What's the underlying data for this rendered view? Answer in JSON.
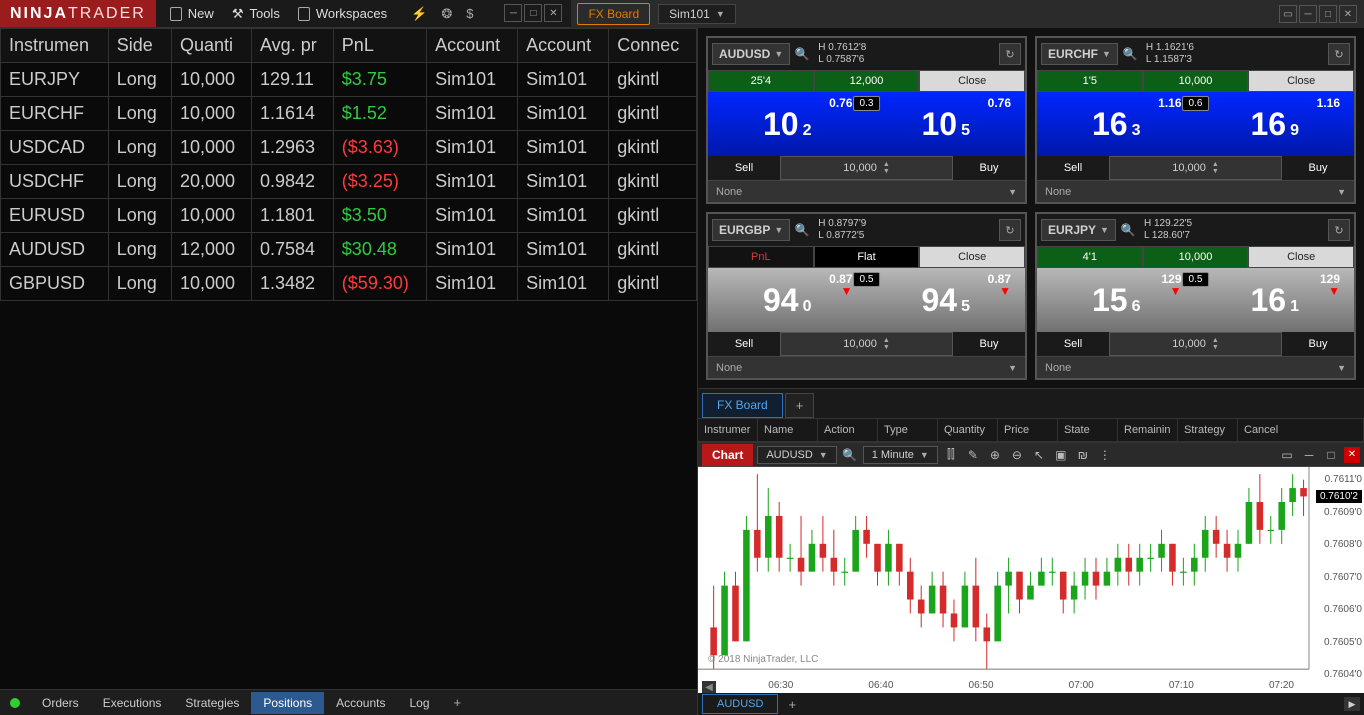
{
  "app": {
    "logo1": "NINJA",
    "logo2": "TRADER",
    "menu": {
      "new": "New",
      "tools": "Tools",
      "workspaces": "Workspaces"
    }
  },
  "fxboard_title": "FX Board",
  "account": "Sim101",
  "positions": {
    "headers": [
      "Instrumen",
      "Side",
      "Quanti",
      "Avg. pr",
      "PnL",
      "Account",
      "Account",
      "Connec"
    ],
    "rows": [
      {
        "inst": "EURJPY",
        "side": "Long",
        "qty": "10,000",
        "avg": "129.11",
        "pnl": "$3.75",
        "pnl_pos": true,
        "acc1": "Sim101",
        "acc2": "Sim101",
        "conn": "gkintl"
      },
      {
        "inst": "EURCHF",
        "side": "Long",
        "qty": "10,000",
        "avg": "1.1614",
        "pnl": "$1.52",
        "pnl_pos": true,
        "acc1": "Sim101",
        "acc2": "Sim101",
        "conn": "gkintl"
      },
      {
        "inst": "USDCAD",
        "side": "Long",
        "qty": "10,000",
        "avg": "1.2963",
        "pnl": "($3.63)",
        "pnl_pos": false,
        "acc1": "Sim101",
        "acc2": "Sim101",
        "conn": "gkintl"
      },
      {
        "inst": "USDCHF",
        "side": "Long",
        "qty": "20,000",
        "avg": "0.9842",
        "pnl": "($3.25)",
        "pnl_pos": false,
        "acc1": "Sim101",
        "acc2": "Sim101",
        "conn": "gkintl"
      },
      {
        "inst": "EURUSD",
        "side": "Long",
        "qty": "10,000",
        "avg": "1.1801",
        "pnl": "$3.50",
        "pnl_pos": true,
        "acc1": "Sim101",
        "acc2": "Sim101",
        "conn": "gkintl"
      },
      {
        "inst": "AUDUSD",
        "side": "Long",
        "qty": "12,000",
        "avg": "0.7584",
        "pnl": "$30.48",
        "pnl_pos": true,
        "acc1": "Sim101",
        "acc2": "Sim101",
        "conn": "gkintl"
      },
      {
        "inst": "GBPUSD",
        "side": "Long",
        "qty": "10,000",
        "avg": "1.3482",
        "pnl": "($59.30)",
        "pnl_pos": false,
        "acc1": "Sim101",
        "acc2": "Sim101",
        "conn": "gkintl"
      }
    ]
  },
  "bottom_tabs": {
    "items": [
      "Orders",
      "Executions",
      "Strategies",
      "Positions",
      "Accounts",
      "Log"
    ],
    "active": "Positions"
  },
  "fx_tiles": [
    {
      "pair": "AUDUSD",
      "hi": "H  0.7612'8",
      "lo": "L  0.7587'6",
      "cell1": "25'4",
      "cell1_cls": "qty",
      "cell2": "12,000",
      "cell2_cls": "qty",
      "cell3": "Close",
      "cell3_cls": "close",
      "left_top": "0.76",
      "left_big": "10",
      "left_sm": "2",
      "right_top": "0.76",
      "right_big": "10",
      "right_sm": "5",
      "spread": "0.3",
      "qty": "10,000",
      "atm": "None",
      "theme": "blue",
      "arrows": false
    },
    {
      "pair": "EURCHF",
      "hi": "H  1.1621'6",
      "lo": "L  1.1587'3",
      "cell1": "1'5",
      "cell1_cls": "qty",
      "cell2": "10,000",
      "cell2_cls": "qty",
      "cell3": "Close",
      "cell3_cls": "close",
      "left_top": "1.16",
      "left_big": "16",
      "left_sm": "3",
      "right_top": "1.16",
      "right_big": "16",
      "right_sm": "9",
      "spread": "0.6",
      "qty": "10,000",
      "atm": "None",
      "theme": "blue",
      "arrows": false
    },
    {
      "pair": "EURGBP",
      "hi": "H  0.8797'9",
      "lo": "L  0.8772'5",
      "cell1": "PnL",
      "cell1_cls": "pnl-label",
      "cell2": "Flat",
      "cell2_cls": "flat",
      "cell3": "Close",
      "cell3_cls": "close",
      "left_top": "0.87",
      "left_big": "94",
      "left_sm": "0",
      "right_top": "0.87",
      "right_big": "94",
      "right_sm": "5",
      "spread": "0.5",
      "qty": "10,000",
      "atm": "None",
      "theme": "gray",
      "arrows": true
    },
    {
      "pair": "EURJPY",
      "hi": "H  129.22'5",
      "lo": "L  128.60'7",
      "cell1": "4'1",
      "cell1_cls": "qty",
      "cell2": "10,000",
      "cell2_cls": "qty",
      "cell3": "Close",
      "cell3_cls": "close",
      "left_top": "129",
      "left_big": "15",
      "left_sm": "6",
      "right_top": "129",
      "right_big": "16",
      "right_sm": "1",
      "spread": "0.5",
      "qty": "10,000",
      "atm": "None",
      "theme": "gray",
      "arrows": true
    }
  ],
  "tile_labels": {
    "sell": "Sell",
    "buy": "Buy"
  },
  "fx_tabrow": {
    "tab": "FX Board"
  },
  "order_headers": [
    "Instrumer",
    "Name",
    "Action",
    "Type",
    "Quantity",
    "Price",
    "State",
    "Remainin",
    "Strategy",
    "Cancel"
  ],
  "chart": {
    "title": "Chart",
    "instrument": "AUDUSD",
    "interval": "1 Minute",
    "copyright": "© 2018 NinjaTrader, LLC",
    "price_tag": "0.7610'2",
    "bottom_tab": "AUDUSD"
  },
  "chart_data": {
    "type": "candlestick",
    "instrument": "AUDUSD",
    "interval": "1 Minute",
    "ylim": [
      0.7604,
      0.7611
    ],
    "yticks": [
      "0.7611'0",
      "0.7609'0",
      "0.7608'0",
      "0.7607'0",
      "0.7606'0",
      "0.7605'0",
      "0.7604'0"
    ],
    "xticks": [
      "06:30",
      "06:40",
      "06:50",
      "07:00",
      "07:10",
      "07:20"
    ],
    "last_price": "0.7610'2",
    "candles": [
      {
        "t": "06:26",
        "o": 0.76055,
        "h": 0.7607,
        "l": 0.7604,
        "c": 0.76045
      },
      {
        "t": "06:27",
        "o": 0.76045,
        "h": 0.76075,
        "l": 0.76045,
        "c": 0.7607
      },
      {
        "t": "06:28",
        "o": 0.7607,
        "h": 0.76075,
        "l": 0.7605,
        "c": 0.7605
      },
      {
        "t": "06:29",
        "o": 0.7605,
        "h": 0.76095,
        "l": 0.7605,
        "c": 0.7609
      },
      {
        "t": "06:30",
        "o": 0.7609,
        "h": 0.7611,
        "l": 0.76075,
        "c": 0.7608
      },
      {
        "t": "06:31",
        "o": 0.7608,
        "h": 0.76105,
        "l": 0.76075,
        "c": 0.76095
      },
      {
        "t": "06:32",
        "o": 0.76095,
        "h": 0.761,
        "l": 0.76075,
        "c": 0.7608
      },
      {
        "t": "06:33",
        "o": 0.7608,
        "h": 0.76085,
        "l": 0.76075,
        "c": 0.7608
      },
      {
        "t": "06:34",
        "o": 0.7608,
        "h": 0.76095,
        "l": 0.7607,
        "c": 0.76075
      },
      {
        "t": "06:35",
        "o": 0.76075,
        "h": 0.7609,
        "l": 0.76075,
        "c": 0.76085
      },
      {
        "t": "06:36",
        "o": 0.76085,
        "h": 0.76095,
        "l": 0.76075,
        "c": 0.7608
      },
      {
        "t": "06:37",
        "o": 0.7608,
        "h": 0.7609,
        "l": 0.7607,
        "c": 0.76075
      },
      {
        "t": "06:38",
        "o": 0.76075,
        "h": 0.7608,
        "l": 0.7607,
        "c": 0.76075
      },
      {
        "t": "06:39",
        "o": 0.76075,
        "h": 0.76095,
        "l": 0.76075,
        "c": 0.7609
      },
      {
        "t": "06:40",
        "o": 0.7609,
        "h": 0.76095,
        "l": 0.7608,
        "c": 0.76085
      },
      {
        "t": "06:41",
        "o": 0.76085,
        "h": 0.76085,
        "l": 0.7607,
        "c": 0.76075
      },
      {
        "t": "06:42",
        "o": 0.76075,
        "h": 0.7609,
        "l": 0.7607,
        "c": 0.76085
      },
      {
        "t": "06:43",
        "o": 0.76085,
        "h": 0.76085,
        "l": 0.7607,
        "c": 0.76075
      },
      {
        "t": "06:44",
        "o": 0.76075,
        "h": 0.7608,
        "l": 0.7606,
        "c": 0.76065
      },
      {
        "t": "06:45",
        "o": 0.76065,
        "h": 0.7607,
        "l": 0.76055,
        "c": 0.7606
      },
      {
        "t": "06:46",
        "o": 0.7606,
        "h": 0.76075,
        "l": 0.7606,
        "c": 0.7607
      },
      {
        "t": "06:47",
        "o": 0.7607,
        "h": 0.76075,
        "l": 0.76055,
        "c": 0.7606
      },
      {
        "t": "06:48",
        "o": 0.7606,
        "h": 0.76065,
        "l": 0.7605,
        "c": 0.76055
      },
      {
        "t": "06:49",
        "o": 0.76055,
        "h": 0.76075,
        "l": 0.76055,
        "c": 0.7607
      },
      {
        "t": "06:50",
        "o": 0.7607,
        "h": 0.7608,
        "l": 0.7605,
        "c": 0.76055
      },
      {
        "t": "06:51",
        "o": 0.76055,
        "h": 0.7606,
        "l": 0.7604,
        "c": 0.7605
      },
      {
        "t": "06:52",
        "o": 0.7605,
        "h": 0.76075,
        "l": 0.7605,
        "c": 0.7607
      },
      {
        "t": "06:53",
        "o": 0.7607,
        "h": 0.7608,
        "l": 0.7606,
        "c": 0.76075
      },
      {
        "t": "06:54",
        "o": 0.76075,
        "h": 0.76075,
        "l": 0.7606,
        "c": 0.76065
      },
      {
        "t": "06:55",
        "o": 0.76065,
        "h": 0.76075,
        "l": 0.76065,
        "c": 0.7607
      },
      {
        "t": "06:56",
        "o": 0.7607,
        "h": 0.7608,
        "l": 0.7607,
        "c": 0.76075
      },
      {
        "t": "06:57",
        "o": 0.76075,
        "h": 0.7608,
        "l": 0.7607,
        "c": 0.76075
      },
      {
        "t": "06:58",
        "o": 0.76075,
        "h": 0.76075,
        "l": 0.7606,
        "c": 0.76065
      },
      {
        "t": "06:59",
        "o": 0.76065,
        "h": 0.76075,
        "l": 0.7606,
        "c": 0.7607
      },
      {
        "t": "07:00",
        "o": 0.7607,
        "h": 0.7608,
        "l": 0.76065,
        "c": 0.76075
      },
      {
        "t": "07:01",
        "o": 0.76075,
        "h": 0.7608,
        "l": 0.76065,
        "c": 0.7607
      },
      {
        "t": "07:02",
        "o": 0.7607,
        "h": 0.7608,
        "l": 0.7607,
        "c": 0.76075
      },
      {
        "t": "07:03",
        "o": 0.76075,
        "h": 0.76085,
        "l": 0.7607,
        "c": 0.7608
      },
      {
        "t": "07:04",
        "o": 0.7608,
        "h": 0.76085,
        "l": 0.7607,
        "c": 0.76075
      },
      {
        "t": "07:05",
        "o": 0.76075,
        "h": 0.76085,
        "l": 0.7607,
        "c": 0.7608
      },
      {
        "t": "07:06",
        "o": 0.7608,
        "h": 0.76085,
        "l": 0.76075,
        "c": 0.7608
      },
      {
        "t": "07:07",
        "o": 0.7608,
        "h": 0.7609,
        "l": 0.76075,
        "c": 0.76085
      },
      {
        "t": "07:08",
        "o": 0.76085,
        "h": 0.76085,
        "l": 0.7607,
        "c": 0.76075
      },
      {
        "t": "07:09",
        "o": 0.76075,
        "h": 0.7608,
        "l": 0.7607,
        "c": 0.76075
      },
      {
        "t": "07:10",
        "o": 0.76075,
        "h": 0.76085,
        "l": 0.7607,
        "c": 0.7608
      },
      {
        "t": "07:11",
        "o": 0.7608,
        "h": 0.76095,
        "l": 0.76075,
        "c": 0.7609
      },
      {
        "t": "07:12",
        "o": 0.7609,
        "h": 0.76095,
        "l": 0.7608,
        "c": 0.76085
      },
      {
        "t": "07:13",
        "o": 0.76085,
        "h": 0.7609,
        "l": 0.76075,
        "c": 0.7608
      },
      {
        "t": "07:14",
        "o": 0.7608,
        "h": 0.7609,
        "l": 0.76075,
        "c": 0.76085
      },
      {
        "t": "07:15",
        "o": 0.76085,
        "h": 0.76105,
        "l": 0.76085,
        "c": 0.761
      },
      {
        "t": "07:16",
        "o": 0.761,
        "h": 0.7611,
        "l": 0.76085,
        "c": 0.7609
      },
      {
        "t": "07:17",
        "o": 0.7609,
        "h": 0.76095,
        "l": 0.76085,
        "c": 0.7609
      },
      {
        "t": "07:18",
        "o": 0.7609,
        "h": 0.76105,
        "l": 0.76085,
        "c": 0.761
      },
      {
        "t": "07:19",
        "o": 0.761,
        "h": 0.7611,
        "l": 0.76095,
        "c": 0.76105
      },
      {
        "t": "07:20",
        "o": 0.76105,
        "h": 0.76108,
        "l": 0.76095,
        "c": 0.76102
      }
    ]
  }
}
